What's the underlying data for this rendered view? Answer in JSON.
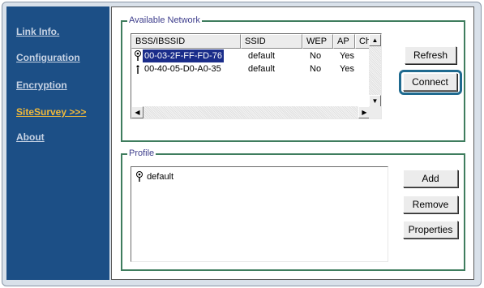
{
  "sidebar": {
    "items": [
      {
        "label": "Link Info.",
        "active": false
      },
      {
        "label": "Configuration",
        "active": false
      },
      {
        "label": "Encryption",
        "active": false
      },
      {
        "label": "SiteSurvey >>>",
        "active": true
      },
      {
        "label": "About",
        "active": false
      }
    ]
  },
  "available_network": {
    "title": "Available Network",
    "columns": [
      "BSS/IBSSID",
      "SSID",
      "WEP",
      "AP",
      "Ch"
    ],
    "rows": [
      {
        "icon": "signal-strong-icon",
        "bssid": "00-03-2F-FF-FD-76",
        "ssid": "default",
        "wep": "No",
        "ap": "Yes",
        "selected": true
      },
      {
        "icon": "signal-weak-icon",
        "bssid": "00-40-05-D0-A0-35",
        "ssid": "default",
        "wep": "No",
        "ap": "Yes",
        "selected": false
      }
    ],
    "refresh_label": "Refresh",
    "connect_label": "Connect"
  },
  "profile": {
    "title": "Profile",
    "items": [
      {
        "icon": "signal-strong-icon",
        "label": "default"
      }
    ],
    "add_label": "Add",
    "remove_label": "Remove",
    "properties_label": "Properties"
  },
  "colors": {
    "sidebar_bg": "#1c4f86",
    "sidebar_link": "#c7d3e4",
    "active_link": "#f0b93a",
    "group_border": "#3f7d5e",
    "selection": "#1a2d8a",
    "focus_ring": "#1f6a8f"
  }
}
